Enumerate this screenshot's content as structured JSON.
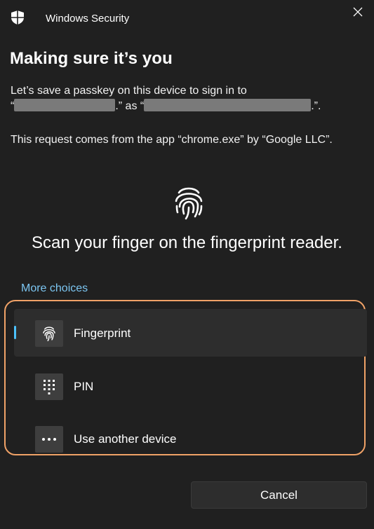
{
  "window": {
    "title": "Windows Security",
    "close_icon": "close-icon"
  },
  "dialog": {
    "heading": "Making sure it’s you",
    "line1": "Let’s save a passkey on this device to sign in to",
    "line2_prefix": "“",
    "line2_middle": ".” as “",
    "line2_suffix": ".”.",
    "request_text": "This request comes from the app “chrome.exe” by “Google LLC”.",
    "scan_instruction": "Scan your finger on the fingerprint reader."
  },
  "choices": {
    "more_choices_label": "More choices",
    "options": [
      {
        "label": "Fingerprint",
        "icon": "fingerprint-icon",
        "selected": true
      },
      {
        "label": "PIN",
        "icon": "keypad-icon",
        "selected": false
      },
      {
        "label": "Use another device",
        "icon": "more-dots-icon",
        "selected": false
      }
    ]
  },
  "footer": {
    "cancel_label": "Cancel"
  },
  "colors": {
    "background": "#202020",
    "accent_link": "#7cc6f2",
    "selection_bar": "#4cc2ff",
    "highlight_border": "#f0a267"
  }
}
